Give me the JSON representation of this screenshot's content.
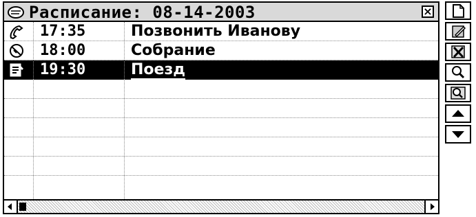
{
  "window": {
    "title": "Расписание: 08-14-2003",
    "close_label": "×"
  },
  "appointments": [
    {
      "icon": "phone-icon",
      "time": "17:35",
      "text": "Позвонить Иванову",
      "selected": false
    },
    {
      "icon": "meeting-icon",
      "time": "18:00",
      "text": "Собрание",
      "selected": false
    },
    {
      "icon": "note-icon",
      "time": "19:30",
      "text": "Поезд",
      "selected": true
    }
  ],
  "empty_rows": 5,
  "toolbar": {
    "buttons": [
      "new-document-icon",
      "edit-icon",
      "delete-icon",
      "search-icon",
      "find-in-record-icon",
      "scroll-up-icon",
      "scroll-down-icon"
    ]
  }
}
